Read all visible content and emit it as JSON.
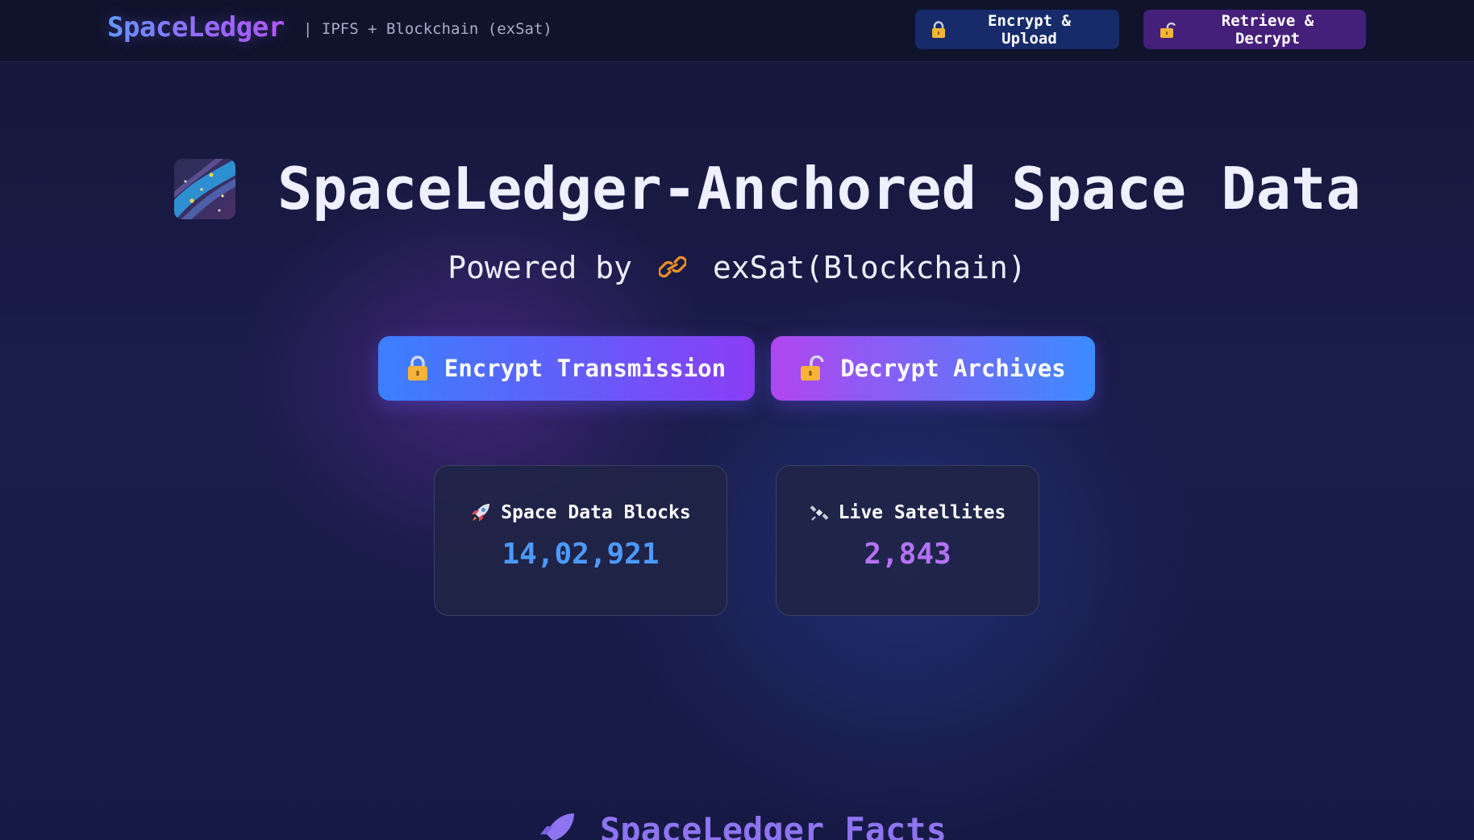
{
  "header": {
    "brand": "SpaceLedger",
    "subtitle": "| IPFS + Blockchain (exSat)",
    "buttons": [
      {
        "label": "Encrypt & Upload",
        "icon": "lock-icon"
      },
      {
        "label": "Retrieve & Decrypt",
        "icon": "unlock-icon"
      }
    ]
  },
  "hero": {
    "icon": "milky-way-icon",
    "title": "SpaceLedger-Anchored Space Data",
    "powered_prefix": "Powered by",
    "powered_icon": "chain-link-icon",
    "powered_name": "exSat(Blockchain)",
    "actions": [
      {
        "label": "Encrypt Transmission",
        "icon": "lock-icon"
      },
      {
        "label": "Decrypt Archives",
        "icon": "unlock-icon"
      }
    ]
  },
  "stats": [
    {
      "label": "Space Data Blocks",
      "value": "14,02,921",
      "icon": "rocket-icon"
    },
    {
      "label": "Live Satellites",
      "value": "2,843",
      "icon": "satellite-icon"
    }
  ],
  "facts": {
    "heading": "SpaceLedger Facts",
    "icon": "rocket-icon"
  },
  "colors": {
    "background": "#14163a",
    "topbar": "#10132c",
    "accent_blue": "#3a80ff",
    "accent_purple": "#8a3df5",
    "stat_blue": "#4c9aff",
    "stat_purple": "#b472f5",
    "link_icon_orange": "#f0902a"
  }
}
